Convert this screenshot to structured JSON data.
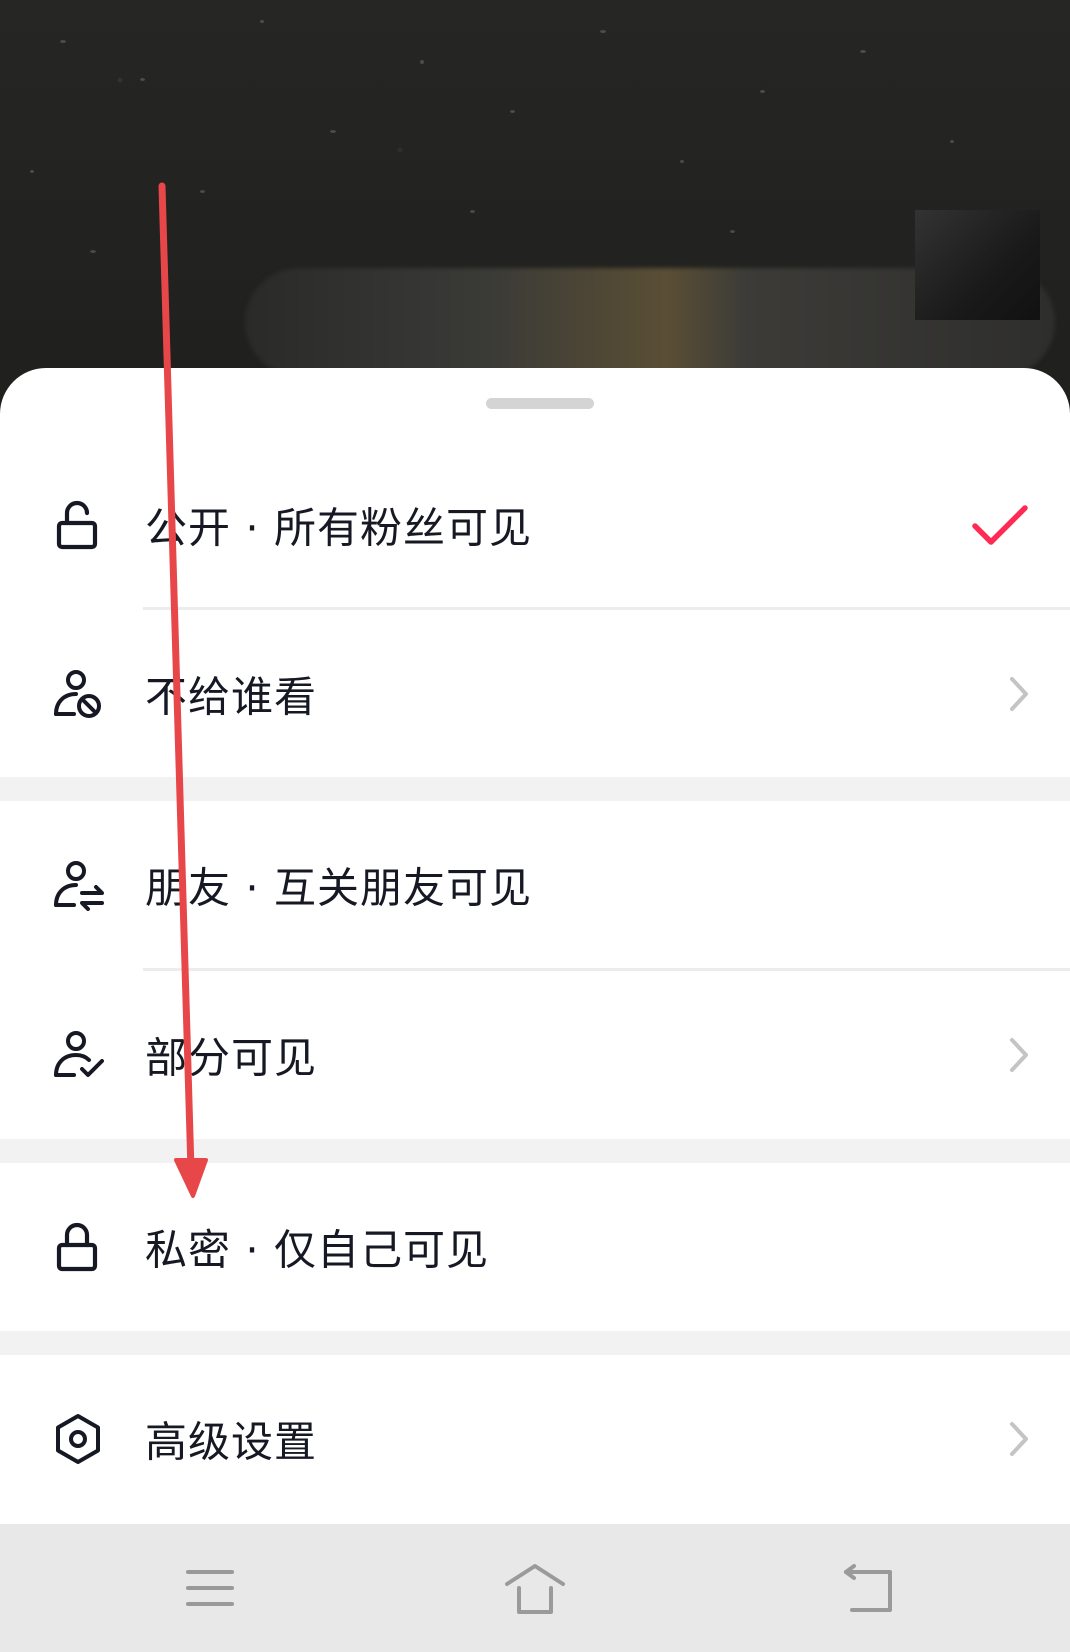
{
  "sheet": {
    "options": [
      {
        "label": "公开 · 所有粉丝可见",
        "icon": "unlock-icon",
        "selected": true
      },
      {
        "label": "不给谁看",
        "icon": "user-blocked-icon",
        "has_chevron": true
      },
      {
        "label": "朋友 · 互关朋友可见",
        "icon": "user-swap-icon"
      },
      {
        "label": "部分可见",
        "icon": "user-check-icon",
        "has_chevron": true
      },
      {
        "label": "私密 · 仅自己可见",
        "icon": "lock-icon"
      },
      {
        "label": "高级设置",
        "icon": "hexagon-settings-icon",
        "has_chevron": true
      }
    ]
  },
  "navbar": {
    "buttons": [
      "menu-icon",
      "home-icon",
      "back-icon"
    ]
  },
  "colors": {
    "accent": "#fe2c55",
    "annotation_arrow": "#e8474a",
    "text": "#161823",
    "chevron": "#c4c4c4"
  }
}
